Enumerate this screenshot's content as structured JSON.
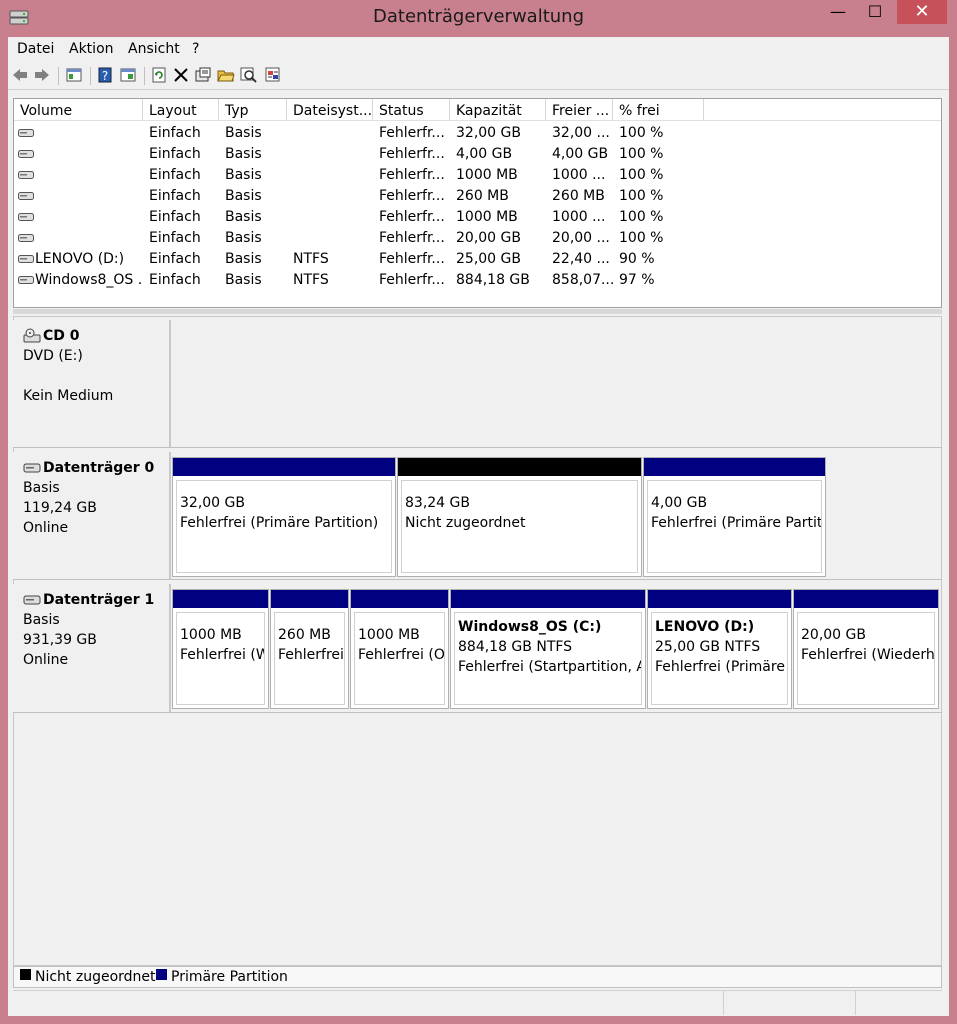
{
  "window": {
    "title": "Datenträgerverwaltung",
    "minimize": "—",
    "maximize": "☐",
    "close": "✕"
  },
  "menu": [
    "Datei",
    "Aktion",
    "Ansicht",
    "?"
  ],
  "volume_table": {
    "columns": [
      "Volume",
      "Layout",
      "Typ",
      "Dateisyst...",
      "Status",
      "Kapazität",
      "Freier ...",
      "% frei"
    ],
    "rows": [
      [
        "",
        "Einfach",
        "Basis",
        "",
        "Fehlerfr...",
        "32,00 GB",
        "32,00 ...",
        "100 %"
      ],
      [
        "",
        "Einfach",
        "Basis",
        "",
        "Fehlerfr...",
        "4,00 GB",
        "4,00 GB",
        "100 %"
      ],
      [
        "",
        "Einfach",
        "Basis",
        "",
        "Fehlerfr...",
        "1000 MB",
        "1000 ...",
        "100 %"
      ],
      [
        "",
        "Einfach",
        "Basis",
        "",
        "Fehlerfr...",
        "260 MB",
        "260 MB",
        "100 %"
      ],
      [
        "",
        "Einfach",
        "Basis",
        "",
        "Fehlerfr...",
        "1000 MB",
        "1000 ...",
        "100 %"
      ],
      [
        "",
        "Einfach",
        "Basis",
        "",
        "Fehlerfr...",
        "20,00 GB",
        "20,00 ...",
        "100 %"
      ],
      [
        "LENOVO (D:)",
        "Einfach",
        "Basis",
        "NTFS",
        "Fehlerfr...",
        "25,00 GB",
        "22,40 ...",
        "90 %"
      ],
      [
        "Windows8_OS ...",
        "Einfach",
        "Basis",
        "NTFS",
        "Fehlerfr...",
        "884,18 GB",
        "858,07...",
        "97 %"
      ]
    ]
  },
  "disks": {
    "cd0": {
      "name": "CD 0",
      "line1": "DVD (E:)",
      "line2": "",
      "line3": "Kein Medium"
    },
    "disk0": {
      "name": "Datenträger 0",
      "line1": "Basis",
      "line2": "119,24 GB",
      "line3": "Online",
      "partitions": [
        {
          "title": "",
          "l1": "32,00 GB",
          "l2": "Fehlerfrei (Primäre Partition)",
          "bar": "#000080"
        },
        {
          "title": "",
          "l1": "83,24 GB",
          "l2": "Nicht zugeordnet",
          "bar": "#000000"
        },
        {
          "title": "",
          "l1": "4,00 GB",
          "l2": "Fehlerfrei (Primäre Partition)",
          "bar": "#000080"
        }
      ]
    },
    "disk1": {
      "name": "Datenträger 1",
      "line1": "Basis",
      "line2": "931,39 GB",
      "line3": "Online",
      "partitions": [
        {
          "title": "",
          "l1": "1000 MB",
          "l2": "Fehlerfrei (Wiederherstellungspartition)",
          "bar": "#000080"
        },
        {
          "title": "",
          "l1": "260 MB",
          "l2": "Fehlerfrei (EFI-Systempartition)",
          "bar": "#000080"
        },
        {
          "title": "",
          "l1": "1000 MB",
          "l2": "Fehlerfrei (OEM-Partition)",
          "bar": "#000080"
        },
        {
          "title": "Windows8_OS  (C:)",
          "l1": "884,18 GB NTFS",
          "l2": "Fehlerfrei (Startpartition, Auslagerungsdatei)",
          "bar": "#000080"
        },
        {
          "title": "LENOVO  (D:)",
          "l1": "25,00 GB NTFS",
          "l2": "Fehlerfrei (Primäre Partition)",
          "bar": "#000080"
        },
        {
          "title": "",
          "l1": "20,00 GB",
          "l2": "Fehlerfrei (Wiederherstellungspartition)",
          "bar": "#000080"
        }
      ]
    }
  },
  "legend": {
    "unallocated": "Nicht zugeordnet",
    "primary": "Primäre Partition",
    "unallocated_color": "#000000",
    "primary_color": "#000080"
  },
  "toolbar_icons": [
    "back-icon",
    "forward-icon",
    "console-tree-icon",
    "help-icon",
    "view-icon",
    "refresh-icon",
    "delete-icon",
    "properties-icon",
    "open-icon",
    "find-icon",
    "settings-icon"
  ]
}
